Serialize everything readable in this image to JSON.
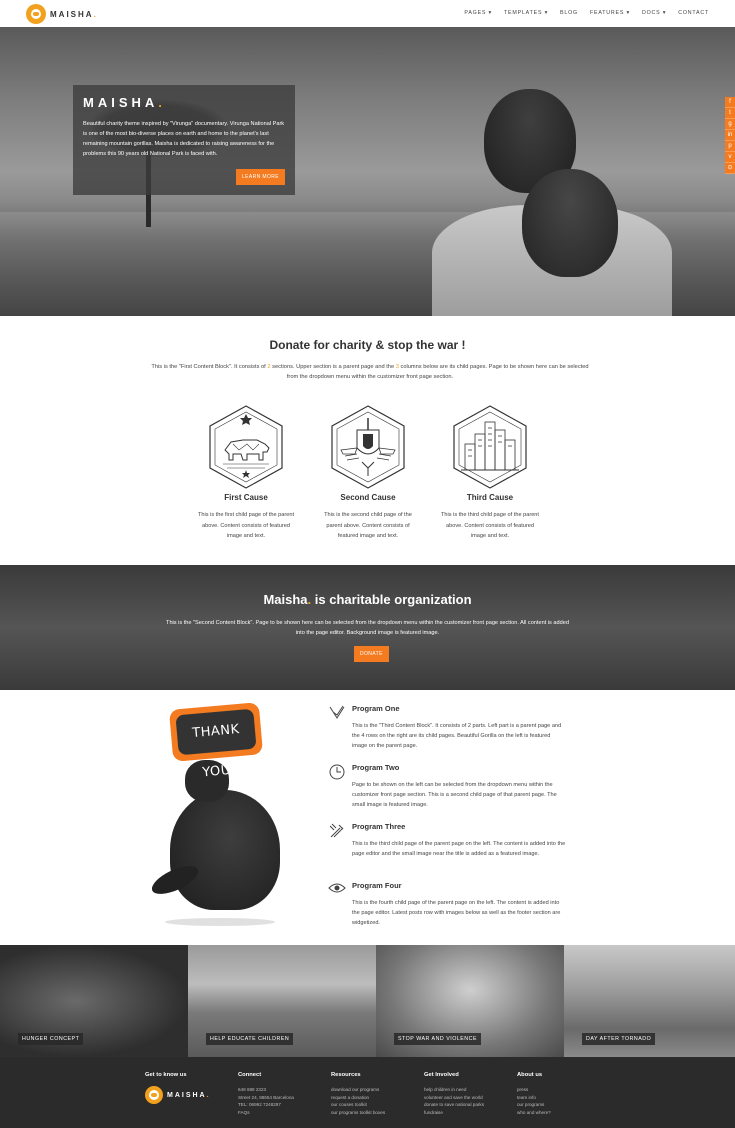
{
  "brand": {
    "name": "MAISHA",
    "accent": "#f47b20",
    "logo_color": "#f2a11e"
  },
  "nav": {
    "items": [
      "PAGES ▾",
      "TEMPLATES ▾",
      "BLOG",
      "FEATURES ▾",
      "DOCS ▾",
      "CONTACT"
    ]
  },
  "hero": {
    "title": "MAISHA",
    "title_dot": ".",
    "text": "Beautiful charity theme inspired by \"Virunga\" documentary. Virunga National Park is one of the most bio-diverse places on earth and home to the planet's last remaining mountain gorillas. Maisha is dedicated to raising awareness for the problems this 90 years old National Park is faced with.",
    "button": "LEARN MORE"
  },
  "social": [
    "f",
    "t",
    "g",
    "in",
    "p",
    "v",
    "⊙"
  ],
  "donate": {
    "title": "Donate for charity & stop the war !",
    "text_a": "This is the \"First Content Block\". It consists of ",
    "num_a": "2",
    "text_b": " sections. Upper section is a parent page and the ",
    "num_b": "3",
    "text_c": " columns below are its child pages. Page to be shown here can be selected from the dropdown menu within the customizer front page section.",
    "causes": [
      {
        "icon": "bear-hexagon-icon",
        "title": "First Cause",
        "text": "This is the first child page of the parent above. Content consists of featured image and text."
      },
      {
        "icon": "shield-wings-hexagon-icon",
        "title": "Second Cause",
        "text": "This is the second child page of the parent above. Content consists of featured image and text."
      },
      {
        "icon": "city-hexagon-icon",
        "title": "Third Cause",
        "text": "This is the third child page of the parent above. Content consists of featured image and text."
      }
    ]
  },
  "org": {
    "title_brand": "Maisha",
    "title_dot": ".",
    "title_rest": " is charitable organization",
    "text": "This is the \"Second Content Block\". Page to be shown here can be selected from the dropdown menu within the customizer front page section. All content is added into the page editor. Background image is featured image.",
    "button": "DONATE"
  },
  "thanks_label": "THANK YOU!",
  "programs": [
    {
      "icon": "heart-check-icon",
      "title": "Program One",
      "text": "This is the \"Third Content Block\". It consists of 2 parts. Left part is a parent page and the 4 rows on the right are its child pages. Beautiful Gorilla on the left is featured image on the parent page."
    },
    {
      "icon": "clock-icon",
      "title": "Program Two",
      "text": "Page to be shown on the left can be selected from the dropdown menu within the customizer front page section. This is a second child page of that parent page. The small image is featured image."
    },
    {
      "icon": "tools-icon",
      "title": "Program Three",
      "text": "This is the third child page of the parent page on the left. The content is added into the page editor and the small image near the title is added as a featured image."
    },
    {
      "icon": "eye-icon",
      "title": "Program Four",
      "text": "This is the fourth child page of the parent page on the left. The content is added into the page editor. Latest posts row with images below as well as the footer section are widgetized."
    }
  ],
  "tiles": [
    "HUNGER CONCEPT",
    "HELP EDUCATE CHILDREN",
    "STOP WAR AND VIOLENCE",
    "DAY AFTER TORNADO"
  ],
  "footer": {
    "cols": [
      {
        "title": "Get to know us",
        "items": []
      },
      {
        "title": "Connect",
        "items": [
          "648 688 2323",
          "Street 24, 88654 Barcelona",
          "TEL: 06992 7248297",
          "FAQs"
        ]
      },
      {
        "title": "Resources",
        "items": [
          "download our programs",
          "request a donation",
          "our couses toolkit",
          "our programs toolkit boxes"
        ]
      },
      {
        "title": "Get Involved",
        "items": [
          "help children in need",
          "volunteer and save the world",
          "donate to save national parks",
          "fundraise"
        ]
      },
      {
        "title": "About us",
        "items": [
          "press",
          "team info",
          "our programs",
          "who and where?"
        ]
      }
    ]
  }
}
